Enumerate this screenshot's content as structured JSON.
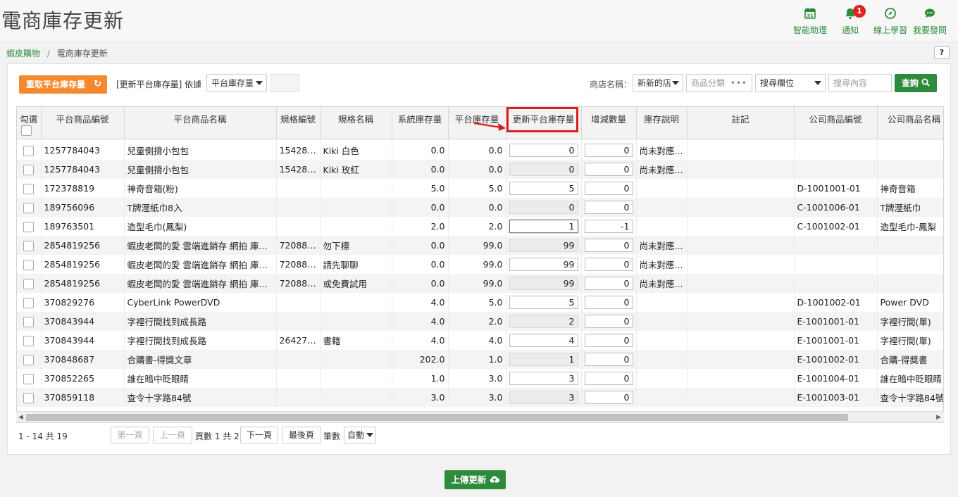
{
  "title": "電商庫存更新",
  "header_actions": [
    {
      "label": "智能助理",
      "icon": "calendar-icon",
      "badge": ""
    },
    {
      "label": "通知",
      "icon": "bell-icon",
      "badge": "1"
    },
    {
      "label": "線上學習",
      "icon": "compass-icon",
      "badge": ""
    },
    {
      "label": "我要發問",
      "icon": "chat-icon",
      "badge": ""
    }
  ],
  "breadcrumb": {
    "parent": "蝦皮購物",
    "separator": "/",
    "current": "電商庫存更新"
  },
  "help": "?",
  "toolbar": {
    "refetch_label": "重取平台庫存量",
    "refetch_icon": "↻",
    "basis_label": "[更新平台庫存量] 依據",
    "basis_select": "平台庫存量",
    "store_label": "商店名稱：",
    "store_select": "新新的店",
    "category_placeholder": "商品分類",
    "category_dots": "•••",
    "search_field_select": "搜尋欄位",
    "search_placeholder": "搜尋內容",
    "query_label": "查詢",
    "query_icon": "search-icon"
  },
  "table": {
    "headers": [
      "勾選",
      "平台商品編號",
      "平台商品名稱",
      "規格編號",
      "規格名稱",
      "系統庫存量",
      "平台庫存量",
      "更新平台庫存量",
      "增減數量",
      "庫存說明",
      "註記",
      "公司商品編號",
      "公司商品名稱"
    ],
    "rows": [
      {
        "id": "1257784043",
        "name": "兒童側揹小包包",
        "spec_no": "154289...",
        "spec_name": "Kiki 白色",
        "sys": "0.0",
        "plat": "0.0",
        "update": "0",
        "update_ro": false,
        "delta": "0",
        "note": "尚未對應...",
        "remark": "",
        "co_no": "",
        "co_name": ""
      },
      {
        "id": "1257784043",
        "name": "兒童側揹小包包",
        "spec_no": "154289...",
        "spec_name": "Kiki 玫紅",
        "sys": "0.0",
        "plat": "0.0",
        "update": "0",
        "update_ro": true,
        "delta": "0",
        "note": "尚未對應...",
        "remark": "",
        "co_no": "",
        "co_name": ""
      },
      {
        "id": "172378819",
        "name": "神奇音箱(粉)",
        "spec_no": "",
        "spec_name": "",
        "sys": "5.0",
        "plat": "5.0",
        "update": "5",
        "update_ro": false,
        "delta": "0",
        "note": "",
        "remark": "",
        "co_no": "D-1001001-01",
        "co_name": "神奇音箱"
      },
      {
        "id": "189756096",
        "name": "T牌溼紙巾8入",
        "spec_no": "",
        "spec_name": "",
        "sys": "0.0",
        "plat": "0.0",
        "update": "0",
        "update_ro": true,
        "delta": "0",
        "note": "",
        "remark": "",
        "co_no": "C-1001006-01",
        "co_name": "T牌溼紙巾"
      },
      {
        "id": "189763501",
        "name": "造型毛巾(鳳梨)",
        "spec_no": "",
        "spec_name": "",
        "sys": "2.0",
        "plat": "2.0",
        "update": "1",
        "update_ro": false,
        "delta": "-1",
        "note": "",
        "remark": "",
        "co_no": "C-1001002-01",
        "co_name": "造型毛巾-鳳梨"
      },
      {
        "id": "2854819256",
        "name": "蝦皮老闆的愛 雲端進銷存 網拍 庫存...",
        "spec_no": "720884...",
        "spec_name": "勿下標",
        "sys": "0.0",
        "plat": "99.0",
        "update": "99",
        "update_ro": true,
        "delta": "0",
        "note": "尚未對應...",
        "remark": "",
        "co_no": "",
        "co_name": ""
      },
      {
        "id": "2854819256",
        "name": "蝦皮老闆的愛 雲端進銷存 網拍 庫存...",
        "spec_no": "720884...",
        "spec_name": "請先聊聊",
        "sys": "0.0",
        "plat": "99.0",
        "update": "99",
        "update_ro": false,
        "delta": "0",
        "note": "尚未對應...",
        "remark": "",
        "co_no": "",
        "co_name": ""
      },
      {
        "id": "2854819256",
        "name": "蝦皮老闆的愛 雲端進銷存 網拍 庫存...",
        "spec_no": "720884...",
        "spec_name": "或免費試用",
        "sys": "0.0",
        "plat": "99.0",
        "update": "99",
        "update_ro": true,
        "delta": "0",
        "note": "尚未對應...",
        "remark": "",
        "co_no": "",
        "co_name": ""
      },
      {
        "id": "370829276",
        "name": "CyberLink PowerDVD",
        "spec_no": "",
        "spec_name": "",
        "sys": "4.0",
        "plat": "5.0",
        "update": "5",
        "update_ro": false,
        "delta": "0",
        "note": "",
        "remark": "",
        "co_no": "D-1001002-01",
        "co_name": "Power DVD"
      },
      {
        "id": "370843944",
        "name": "字裡行間找到成長路",
        "spec_no": "",
        "spec_name": "",
        "sys": "4.0",
        "plat": "2.0",
        "update": "2",
        "update_ro": true,
        "delta": "0",
        "note": "",
        "remark": "",
        "co_no": "E-1001001-01",
        "co_name": "字裡行間(單)"
      },
      {
        "id": "370843944",
        "name": "字裡行間找到成長路",
        "spec_no": "264276...",
        "spec_name": "書籍",
        "sys": "4.0",
        "plat": "4.0",
        "update": "4",
        "update_ro": false,
        "delta": "0",
        "note": "",
        "remark": "",
        "co_no": "E-1001001-01",
        "co_name": "字裡行間(單)"
      },
      {
        "id": "370848687",
        "name": "合購書-得獎文章",
        "spec_no": "",
        "spec_name": "",
        "sys": "202.0",
        "plat": "1.0",
        "update": "1",
        "update_ro": true,
        "delta": "0",
        "note": "",
        "remark": "",
        "co_no": "E-1001002-01",
        "co_name": "合購-得獎書"
      },
      {
        "id": "370852265",
        "name": "誰在暗中眨眼睛",
        "spec_no": "",
        "spec_name": "",
        "sys": "1.0",
        "plat": "3.0",
        "update": "3",
        "update_ro": false,
        "delta": "0",
        "note": "",
        "remark": "",
        "co_no": "E-1001004-01",
        "co_name": "誰在暗中眨眼睛"
      },
      {
        "id": "370859118",
        "name": "查令十字路84號",
        "spec_no": "",
        "spec_name": "",
        "sys": "3.0",
        "plat": "3.0",
        "update": "3",
        "update_ro": true,
        "delta": "0",
        "note": "",
        "remark": "",
        "co_no": "E-1001003-01",
        "co_name": "查令十字路84號"
      }
    ]
  },
  "pager": {
    "summary": "1 - 14 共 19",
    "first": "第一頁",
    "prev": "上一頁",
    "page_info": "頁數 1 共 2",
    "next": "下一頁",
    "last": "最後頁",
    "size_label": "筆數",
    "size_value": "自動"
  },
  "upload_label": "上傳更新",
  "upload_icon": "cloud-upload-icon",
  "colors": {
    "brand_green": "#2e8b3c",
    "orange": "#f6892e",
    "highlight_red": "#d62020"
  }
}
